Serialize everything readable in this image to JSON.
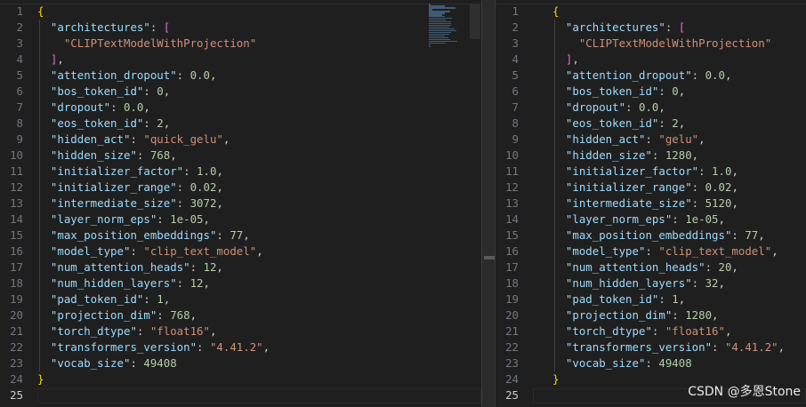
{
  "watermark": "CSDN @多恩Stone",
  "colors": {
    "key": "#9cdcfe",
    "string": "#ce9178",
    "number": "#b5cea8",
    "brace": "#ffd700",
    "bracket": "#da70d6"
  },
  "left_editor": {
    "lines": [
      [
        [
          "b1",
          "{"
        ]
      ],
      [
        [
          "p",
          "  "
        ],
        [
          "k",
          "\"architectures\""
        ],
        [
          "p",
          ": "
        ],
        [
          "b2",
          "["
        ]
      ],
      [
        [
          "p",
          "    "
        ],
        [
          "s",
          "\"CLIPTextModelWithProjection\""
        ]
      ],
      [
        [
          "p",
          "  "
        ],
        [
          "b2",
          "]"
        ],
        [
          "p",
          ","
        ]
      ],
      [
        [
          "p",
          "  "
        ],
        [
          "k",
          "\"attention_dropout\""
        ],
        [
          "p",
          ": "
        ],
        [
          "n",
          "0.0"
        ],
        [
          "p",
          ","
        ]
      ],
      [
        [
          "p",
          "  "
        ],
        [
          "k",
          "\"bos_token_id\""
        ],
        [
          "p",
          ": "
        ],
        [
          "n",
          "0"
        ],
        [
          "p",
          ","
        ]
      ],
      [
        [
          "p",
          "  "
        ],
        [
          "k",
          "\"dropout\""
        ],
        [
          "p",
          ": "
        ],
        [
          "n",
          "0.0"
        ],
        [
          "p",
          ","
        ]
      ],
      [
        [
          "p",
          "  "
        ],
        [
          "k",
          "\"eos_token_id\""
        ],
        [
          "p",
          ": "
        ],
        [
          "n",
          "2"
        ],
        [
          "p",
          ","
        ]
      ],
      [
        [
          "p",
          "  "
        ],
        [
          "k",
          "\"hidden_act\""
        ],
        [
          "p",
          ": "
        ],
        [
          "s",
          "\"quick_gelu\""
        ],
        [
          "p",
          ","
        ]
      ],
      [
        [
          "p",
          "  "
        ],
        [
          "k",
          "\"hidden_size\""
        ],
        [
          "p",
          ": "
        ],
        [
          "n",
          "768"
        ],
        [
          "p",
          ","
        ]
      ],
      [
        [
          "p",
          "  "
        ],
        [
          "k",
          "\"initializer_factor\""
        ],
        [
          "p",
          ": "
        ],
        [
          "n",
          "1.0"
        ],
        [
          "p",
          ","
        ]
      ],
      [
        [
          "p",
          "  "
        ],
        [
          "k",
          "\"initializer_range\""
        ],
        [
          "p",
          ": "
        ],
        [
          "n",
          "0.02"
        ],
        [
          "p",
          ","
        ]
      ],
      [
        [
          "p",
          "  "
        ],
        [
          "k",
          "\"intermediate_size\""
        ],
        [
          "p",
          ": "
        ],
        [
          "n",
          "3072"
        ],
        [
          "p",
          ","
        ]
      ],
      [
        [
          "p",
          "  "
        ],
        [
          "k",
          "\"layer_norm_eps\""
        ],
        [
          "p",
          ": "
        ],
        [
          "n",
          "1e-05"
        ],
        [
          "p",
          ","
        ]
      ],
      [
        [
          "p",
          "  "
        ],
        [
          "k",
          "\"max_position_embeddings\""
        ],
        [
          "p",
          ": "
        ],
        [
          "n",
          "77"
        ],
        [
          "p",
          ","
        ]
      ],
      [
        [
          "p",
          "  "
        ],
        [
          "k",
          "\"model_type\""
        ],
        [
          "p",
          ": "
        ],
        [
          "s",
          "\"clip_text_model\""
        ],
        [
          "p",
          ","
        ]
      ],
      [
        [
          "p",
          "  "
        ],
        [
          "k",
          "\"num_attention_heads\""
        ],
        [
          "p",
          ": "
        ],
        [
          "n",
          "12"
        ],
        [
          "p",
          ","
        ]
      ],
      [
        [
          "p",
          "  "
        ],
        [
          "k",
          "\"num_hidden_layers\""
        ],
        [
          "p",
          ": "
        ],
        [
          "n",
          "12"
        ],
        [
          "p",
          ","
        ]
      ],
      [
        [
          "p",
          "  "
        ],
        [
          "k",
          "\"pad_token_id\""
        ],
        [
          "p",
          ": "
        ],
        [
          "n",
          "1"
        ],
        [
          "p",
          ","
        ]
      ],
      [
        [
          "p",
          "  "
        ],
        [
          "k",
          "\"projection_dim\""
        ],
        [
          "p",
          ": "
        ],
        [
          "n",
          "768"
        ],
        [
          "p",
          ","
        ]
      ],
      [
        [
          "p",
          "  "
        ],
        [
          "k",
          "\"torch_dtype\""
        ],
        [
          "p",
          ": "
        ],
        [
          "s",
          "\"float16\""
        ],
        [
          "p",
          ","
        ]
      ],
      [
        [
          "p",
          "  "
        ],
        [
          "k",
          "\"transformers_version\""
        ],
        [
          "p",
          ": "
        ],
        [
          "s",
          "\"4.41.2\""
        ],
        [
          "p",
          ","
        ]
      ],
      [
        [
          "p",
          "  "
        ],
        [
          "k",
          "\"vocab_size\""
        ],
        [
          "p",
          ": "
        ],
        [
          "n",
          "49408"
        ]
      ],
      [
        [
          "b1",
          "}"
        ]
      ],
      []
    ]
  },
  "right_editor": {
    "lines": [
      [
        [
          "b1",
          "{"
        ]
      ],
      [
        [
          "p",
          "  "
        ],
        [
          "k",
          "\"architectures\""
        ],
        [
          "p",
          ": "
        ],
        [
          "b2",
          "["
        ]
      ],
      [
        [
          "p",
          "    "
        ],
        [
          "s",
          "\"CLIPTextModelWithProjection\""
        ]
      ],
      [
        [
          "p",
          "  "
        ],
        [
          "b2",
          "]"
        ],
        [
          "p",
          ","
        ]
      ],
      [
        [
          "p",
          "  "
        ],
        [
          "k",
          "\"attention_dropout\""
        ],
        [
          "p",
          ": "
        ],
        [
          "n",
          "0.0"
        ],
        [
          "p",
          ","
        ]
      ],
      [
        [
          "p",
          "  "
        ],
        [
          "k",
          "\"bos_token_id\""
        ],
        [
          "p",
          ": "
        ],
        [
          "n",
          "0"
        ],
        [
          "p",
          ","
        ]
      ],
      [
        [
          "p",
          "  "
        ],
        [
          "k",
          "\"dropout\""
        ],
        [
          "p",
          ": "
        ],
        [
          "n",
          "0.0"
        ],
        [
          "p",
          ","
        ]
      ],
      [
        [
          "p",
          "  "
        ],
        [
          "k",
          "\"eos_token_id\""
        ],
        [
          "p",
          ": "
        ],
        [
          "n",
          "2"
        ],
        [
          "p",
          ","
        ]
      ],
      [
        [
          "p",
          "  "
        ],
        [
          "k",
          "\"hidden_act\""
        ],
        [
          "p",
          ": "
        ],
        [
          "s",
          "\"gelu\""
        ],
        [
          "p",
          ","
        ]
      ],
      [
        [
          "p",
          "  "
        ],
        [
          "k",
          "\"hidden_size\""
        ],
        [
          "p",
          ": "
        ],
        [
          "n",
          "1280"
        ],
        [
          "p",
          ","
        ]
      ],
      [
        [
          "p",
          "  "
        ],
        [
          "k",
          "\"initializer_factor\""
        ],
        [
          "p",
          ": "
        ],
        [
          "n",
          "1.0"
        ],
        [
          "p",
          ","
        ]
      ],
      [
        [
          "p",
          "  "
        ],
        [
          "k",
          "\"initializer_range\""
        ],
        [
          "p",
          ": "
        ],
        [
          "n",
          "0.02"
        ],
        [
          "p",
          ","
        ]
      ],
      [
        [
          "p",
          "  "
        ],
        [
          "k",
          "\"intermediate_size\""
        ],
        [
          "p",
          ": "
        ],
        [
          "n",
          "5120"
        ],
        [
          "p",
          ","
        ]
      ],
      [
        [
          "p",
          "  "
        ],
        [
          "k",
          "\"layer_norm_eps\""
        ],
        [
          "p",
          ": "
        ],
        [
          "n",
          "1e-05"
        ],
        [
          "p",
          ","
        ]
      ],
      [
        [
          "p",
          "  "
        ],
        [
          "k",
          "\"max_position_embeddings\""
        ],
        [
          "p",
          ": "
        ],
        [
          "n",
          "77"
        ],
        [
          "p",
          ","
        ]
      ],
      [
        [
          "p",
          "  "
        ],
        [
          "k",
          "\"model_type\""
        ],
        [
          "p",
          ": "
        ],
        [
          "s",
          "\"clip_text_model\""
        ],
        [
          "p",
          ","
        ]
      ],
      [
        [
          "p",
          "  "
        ],
        [
          "k",
          "\"num_attention_heads\""
        ],
        [
          "p",
          ": "
        ],
        [
          "n",
          "20"
        ],
        [
          "p",
          ","
        ]
      ],
      [
        [
          "p",
          "  "
        ],
        [
          "k",
          "\"num_hidden_layers\""
        ],
        [
          "p",
          ": "
        ],
        [
          "n",
          "32"
        ],
        [
          "p",
          ","
        ]
      ],
      [
        [
          "p",
          "  "
        ],
        [
          "k",
          "\"pad_token_id\""
        ],
        [
          "p",
          ": "
        ],
        [
          "n",
          "1"
        ],
        [
          "p",
          ","
        ]
      ],
      [
        [
          "p",
          "  "
        ],
        [
          "k",
          "\"projection_dim\""
        ],
        [
          "p",
          ": "
        ],
        [
          "n",
          "1280"
        ],
        [
          "p",
          ","
        ]
      ],
      [
        [
          "p",
          "  "
        ],
        [
          "k",
          "\"torch_dtype\""
        ],
        [
          "p",
          ": "
        ],
        [
          "s",
          "\"float16\""
        ],
        [
          "p",
          ","
        ]
      ],
      [
        [
          "p",
          "  "
        ],
        [
          "k",
          "\"transformers_version\""
        ],
        [
          "p",
          ": "
        ],
        [
          "s",
          "\"4.41.2\""
        ],
        [
          "p",
          ","
        ]
      ],
      [
        [
          "p",
          "  "
        ],
        [
          "k",
          "\"vocab_size\""
        ],
        [
          "p",
          ": "
        ],
        [
          "n",
          "49408"
        ]
      ],
      [
        [
          "b1",
          "}"
        ]
      ],
      []
    ]
  }
}
